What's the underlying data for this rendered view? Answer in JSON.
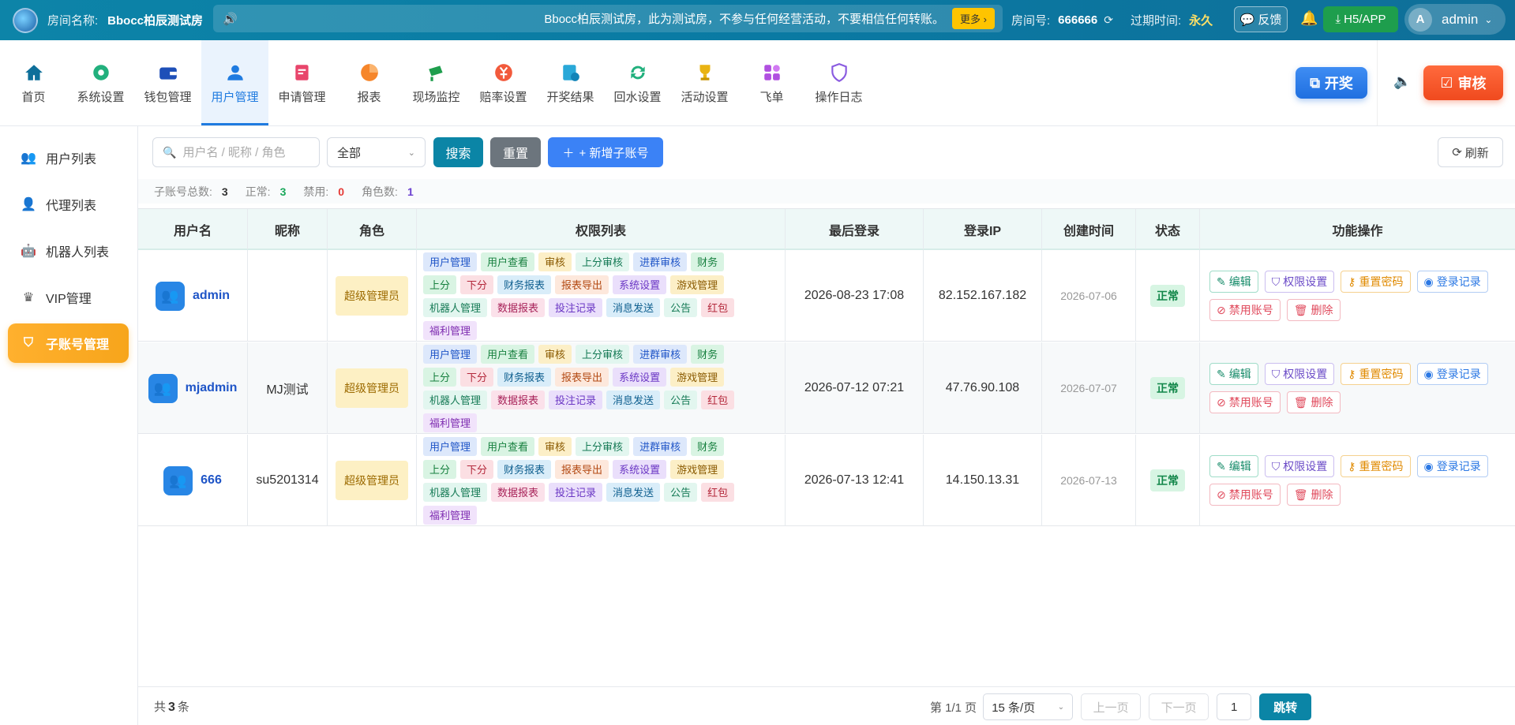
{
  "topbar": {
    "room_label": "房间名称:",
    "room_name": "Bbocc柏辰测试房",
    "notice_text": "Bbocc柏辰测试房，此为测试房，不参与任何经营活动，不要相信任何转账。",
    "more_label": "更多 ›",
    "room_no_label": "房间号:",
    "room_no": "666666",
    "expire_label": "过期时间:",
    "expire_value": "永久",
    "feedback_label": "反馈",
    "h5_label": "H5/APP",
    "avatar_letter": "A",
    "username": "admin"
  },
  "nav": {
    "items": [
      {
        "label": "首页",
        "icon": "home-icon"
      },
      {
        "label": "系统设置",
        "icon": "gear-icon"
      },
      {
        "label": "钱包管理",
        "icon": "wallet-icon"
      },
      {
        "label": "用户管理",
        "icon": "user-icon"
      },
      {
        "label": "申请管理",
        "icon": "form-icon"
      },
      {
        "label": "报表",
        "icon": "pie-chart-icon"
      },
      {
        "label": "现场监控",
        "icon": "camera-icon"
      },
      {
        "label": "赔率设置",
        "icon": "odds-icon"
      },
      {
        "label": "开奖结果",
        "icon": "result-icon"
      },
      {
        "label": "回水设置",
        "icon": "refresh-icon"
      },
      {
        "label": "活动设置",
        "icon": "trophy-icon"
      },
      {
        "label": "飞单",
        "icon": "grid-icon"
      },
      {
        "label": "操作日志",
        "icon": "shield-icon"
      }
    ],
    "draw_label": "开奖",
    "audit_label": "审核"
  },
  "sidebar": {
    "items": [
      {
        "label": "用户列表",
        "icon": "users-icon"
      },
      {
        "label": "代理列表",
        "icon": "agent-icon"
      },
      {
        "label": "机器人列表",
        "icon": "robot-icon"
      },
      {
        "label": "VIP管理",
        "icon": "crown-icon"
      },
      {
        "label": "子账号管理",
        "icon": "shield-check-icon"
      }
    ]
  },
  "toolbar": {
    "search_placeholder": "用户名 / 昵称 / 角色",
    "filter_value": "全部",
    "search_label": "搜索",
    "reset_label": "重置",
    "add_label": "+ 新增子账号",
    "refresh_label": "刷新"
  },
  "stats": {
    "total_label": "子账号总数:",
    "total": "3",
    "normal_label": "正常:",
    "normal": "3",
    "ban_label": "禁用:",
    "ban": "0",
    "role_label": "角色数:",
    "role": "1"
  },
  "table": {
    "headers": [
      "用户名",
      "昵称",
      "角色",
      "权限列表",
      "最后登录",
      "登录IP",
      "创建时间",
      "状态",
      "功能操作"
    ],
    "rows": [
      {
        "username": "admin",
        "nickname": "",
        "role": "超级管理员",
        "last_login": "2026-08-23 17:08",
        "ip": "82.152.167.182",
        "created": "2026-07-06",
        "status": "正常"
      },
      {
        "username": "mjadmin",
        "nickname": "MJ测试",
        "role": "超级管理员",
        "last_login": "2026-07-12 07:21",
        "ip": "47.76.90.108",
        "created": "2026-07-07",
        "status": "正常"
      },
      {
        "username": "666",
        "nickname": "su5201314",
        "role": "超级管理员",
        "last_login": "2026-07-13 12:41",
        "ip": "14.150.13.31",
        "created": "2026-07-13",
        "status": "正常"
      }
    ],
    "permissions": [
      "用户管理",
      "用户查看",
      "审核",
      "上分审核",
      "进群审核",
      "财务",
      "上分",
      "下分",
      "财务报表",
      "报表导出",
      "系统设置",
      "游戏管理",
      "机器人管理",
      "数据报表",
      "投注记录",
      "消息发送",
      "公告",
      "红包",
      "福利管理"
    ],
    "ops": {
      "edit": "编辑",
      "perm": "权限设置",
      "pwd": "重置密码",
      "log": "登录记录",
      "ban": "禁用账号",
      "del": "删除"
    }
  },
  "footer": {
    "total_prefix": "共",
    "total": "3",
    "total_suffix": "条",
    "page_info": "第 1/1 页",
    "page_size": "15 条/页",
    "prev": "上一页",
    "next": "下一页",
    "page_input": "1",
    "go": "跳转"
  }
}
